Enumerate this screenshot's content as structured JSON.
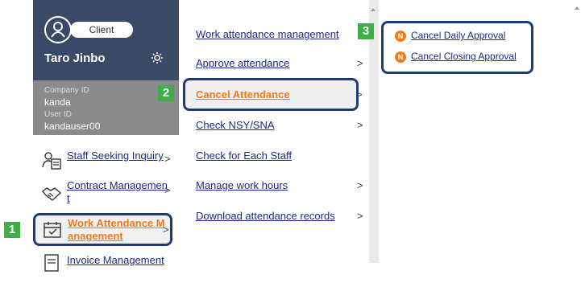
{
  "profile": {
    "role_pill": "Client",
    "user_name": "Taro Jinbo",
    "company_id_label": "Company ID",
    "company_id": "kanda",
    "user_id_label": "User ID",
    "user_id": "kandauser00"
  },
  "sidebar": {
    "items": [
      {
        "label": "Staff Seeking Inquiry",
        "icon": "clipboard-user-icon"
      },
      {
        "label_line1": "Contract Managemen",
        "label_line2": "t",
        "icon": "handshake-icon"
      },
      {
        "label_line1": "Work Attendance M",
        "label_line2": "anagement",
        "icon": "calendar-check-icon"
      },
      {
        "label": "Invoice Management",
        "icon": "invoice-icon"
      }
    ]
  },
  "menu": {
    "items": [
      {
        "label": "Work attendance management",
        "chevron": ""
      },
      {
        "label": "Approve attendance",
        "chevron": ">"
      },
      {
        "label": "Cancel Attendance",
        "chevron": ">"
      },
      {
        "label": "Check NSY/SNA",
        "chevron": ">"
      },
      {
        "label": "Check for Each Staff",
        "chevron": ""
      },
      {
        "label": "Manage work hours",
        "chevron": ">"
      },
      {
        "label": "Download attendance records",
        "chevron": ">"
      }
    ]
  },
  "submenu": {
    "items": [
      {
        "badge": "N",
        "label": "Cancel Daily Approval"
      },
      {
        "badge": "N",
        "label": "Cancel Closing Approval"
      }
    ]
  },
  "badges": [
    "1",
    "2",
    "3"
  ],
  "chevron": ">",
  "colors": {
    "accent": "#ef7b1a",
    "frame": "#1e3a78",
    "badge": "#3fae4a",
    "sidebar_dark": "#3a4a66"
  }
}
